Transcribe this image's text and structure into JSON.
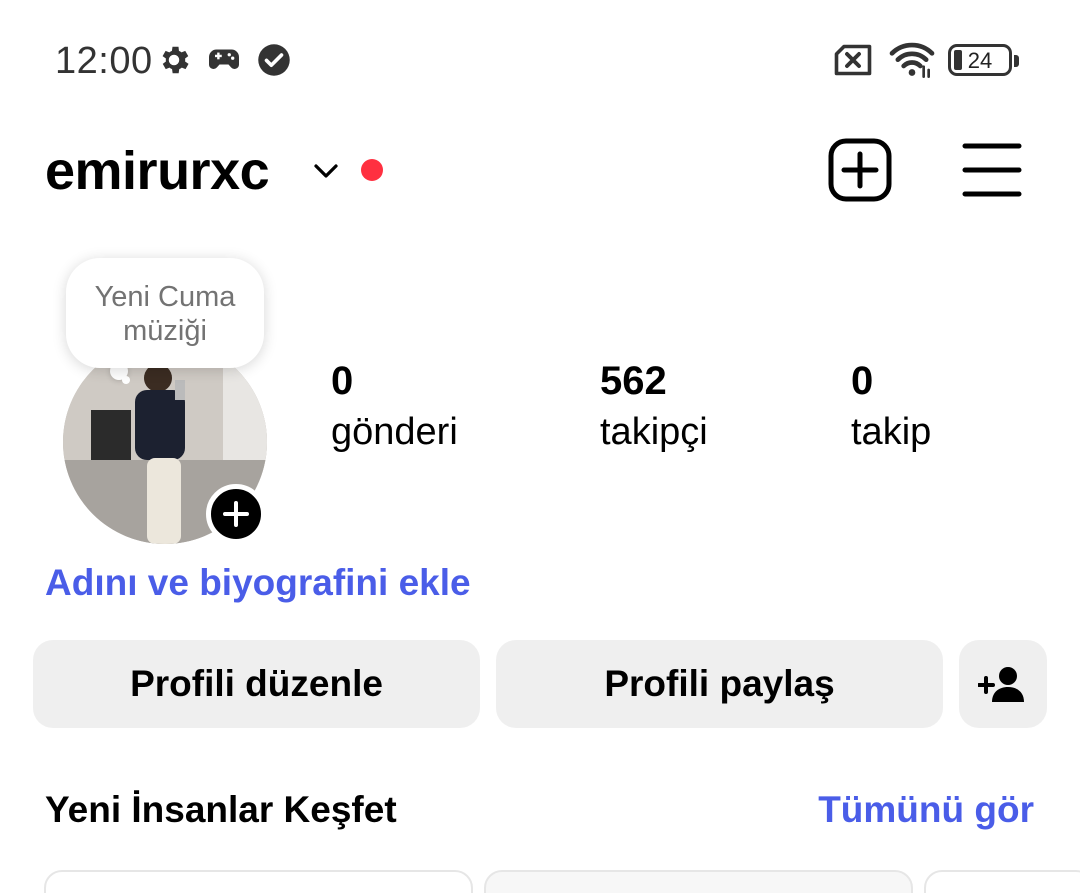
{
  "status_bar": {
    "time": "12:00",
    "left_icons": [
      "gear-icon",
      "gamepad-icon",
      "check-circle-icon"
    ],
    "right_icons": [
      "no-sim-icon",
      "wifi-icon"
    ],
    "battery": "24"
  },
  "header": {
    "username": "emirurxc",
    "notification_dot_color": "#ff3040",
    "icons": [
      "chevron-down-icon",
      "new-post-icon",
      "menu-icon"
    ]
  },
  "profile": {
    "note_bubble": "Yeni Cuma müziği",
    "stats": [
      {
        "count": "0",
        "label": "gönderi"
      },
      {
        "count": "562",
        "label": "takipçi"
      },
      {
        "count": "0",
        "label": "takip"
      }
    ],
    "bio_link": "Adını ve biyografini ekle",
    "link_color": "#4a5de8"
  },
  "actions": {
    "edit_profile": "Profili düzenle",
    "share_profile": "Profili paylaş"
  },
  "discover": {
    "title": "Yeni İnsanlar Keşfet",
    "see_all": "Tümünü gör"
  }
}
